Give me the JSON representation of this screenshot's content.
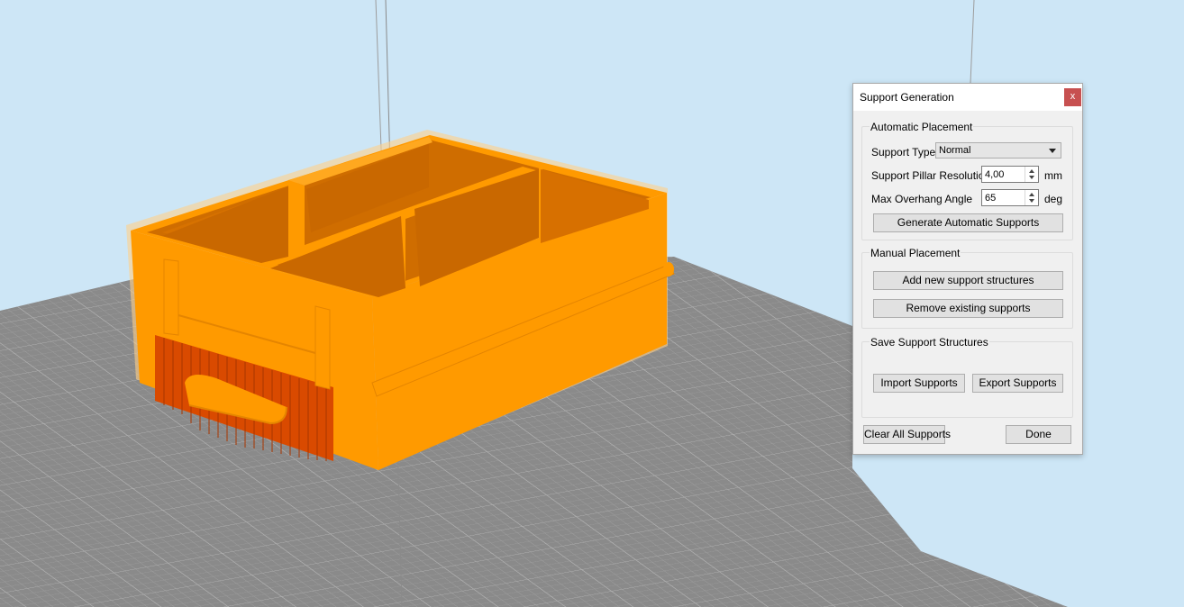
{
  "dialog": {
    "title": "Support Generation",
    "close_label": "x",
    "automatic": {
      "group_label": "Automatic Placement",
      "support_type_label": "Support Type",
      "support_type_value": "Normal",
      "pillar_resolution_label": "Support Pillar Resolution",
      "pillar_resolution_value": "4,00",
      "pillar_resolution_unit": "mm",
      "overhang_label": "Max Overhang Angle",
      "overhang_value": "65",
      "overhang_unit": "deg",
      "generate_button": "Generate Automatic Supports"
    },
    "manual": {
      "group_label": "Manual Placement",
      "add_button": "Add new support structures",
      "remove_button": "Remove existing supports"
    },
    "save": {
      "group_label": "Save Support Structures",
      "import_button": "Import Supports",
      "export_button": "Export Supports"
    },
    "clear_button": "Clear All Supports",
    "done_button": "Done"
  },
  "colors": {
    "background": "#cde6f6",
    "model": "#ff9a00",
    "model_shadow": "#cf6d00",
    "supports": "#d94a00",
    "build_plate": "#8a8a8a",
    "grid_line": "#a8a8a8",
    "close_button": "#c75050"
  }
}
